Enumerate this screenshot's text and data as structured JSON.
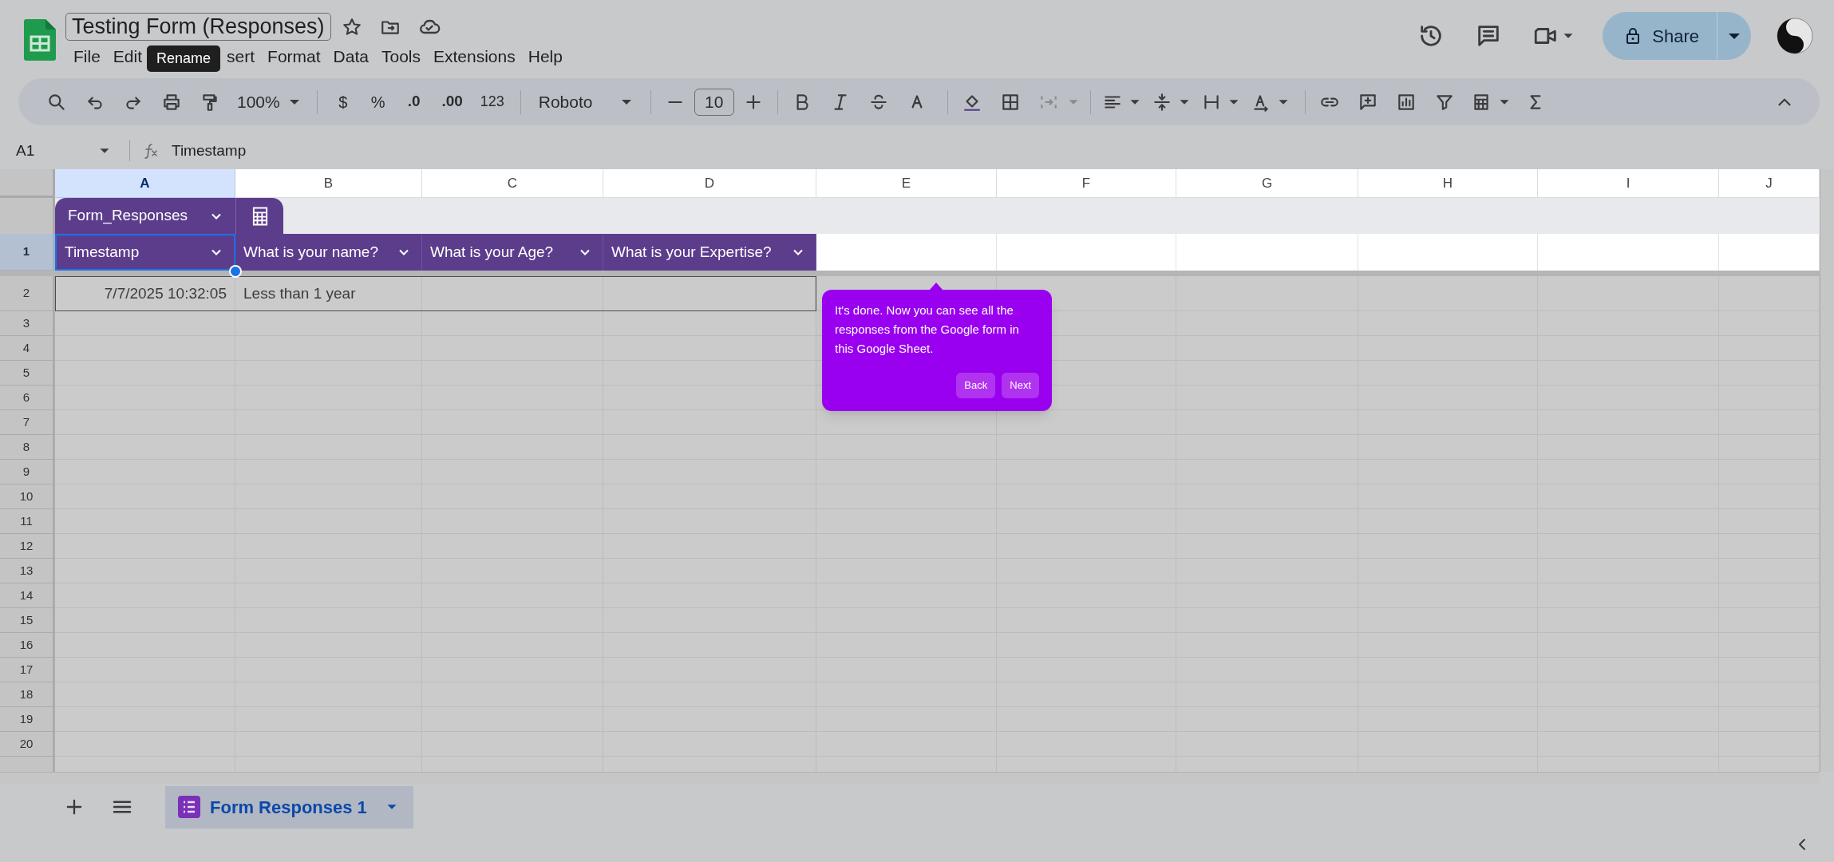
{
  "app": {
    "title": "Testing Form (Responses)",
    "share_label": "Share",
    "menu": [
      {
        "kind": "item",
        "label": "File"
      },
      {
        "kind": "item",
        "label": "Edit"
      },
      {
        "kind": "tooltip",
        "label": "Rename"
      },
      {
        "kind": "item",
        "label": "sert"
      },
      {
        "kind": "item",
        "label": "Format"
      },
      {
        "kind": "item",
        "label": "Data"
      },
      {
        "kind": "item",
        "label": "Tools"
      },
      {
        "kind": "item",
        "label": "Extensions"
      },
      {
        "kind": "item",
        "label": "Help"
      }
    ]
  },
  "toolbar": {
    "zoom": "100%",
    "currency": "$",
    "percent": "%",
    "decrease_decimals": ".0",
    "increase_decimals": ".00",
    "number_format": "123",
    "font": "Roboto",
    "font_size": "10"
  },
  "formula_bar": {
    "cell": "A1",
    "content": "Timestamp"
  },
  "columns": [
    {
      "label": "A",
      "selected": true
    },
    {
      "label": "B",
      "selected": false
    },
    {
      "label": "C",
      "selected": false
    },
    {
      "label": "D",
      "selected": false
    },
    {
      "label": "E",
      "selected": false
    },
    {
      "label": "F",
      "selected": false
    },
    {
      "label": "G",
      "selected": false
    },
    {
      "label": "H",
      "selected": false
    },
    {
      "label": "I",
      "selected": false
    },
    {
      "label": "J",
      "selected": false
    }
  ],
  "table": {
    "name": "Form_Responses",
    "headers": [
      {
        "label": "Timestamp",
        "selected": true
      },
      {
        "label": "What is your name?",
        "selected": false
      },
      {
        "label": "What is your Age?",
        "selected": false
      },
      {
        "label": "What is your Expertise?",
        "selected": false
      }
    ],
    "rows": [
      [
        {
          "text": "7/7/2025 10:32:05",
          "kind": "date"
        },
        {
          "text": "Less than 1 year",
          "kind": "text"
        }
      ]
    ]
  },
  "row_numbers": [
    {
      "label": "1",
      "selected": true
    },
    {
      "label": "2",
      "selected": false
    },
    {
      "label": "3",
      "selected": false
    },
    {
      "label": "4",
      "selected": false
    },
    {
      "label": "5",
      "selected": false
    },
    {
      "label": "6",
      "selected": false
    },
    {
      "label": "7",
      "selected": false
    },
    {
      "label": "8",
      "selected": false
    },
    {
      "label": "9",
      "selected": false
    },
    {
      "label": "10",
      "selected": false
    },
    {
      "label": "11",
      "selected": false
    },
    {
      "label": "12",
      "selected": false
    },
    {
      "label": "13",
      "selected": false
    },
    {
      "label": "14",
      "selected": false
    },
    {
      "label": "15",
      "selected": false
    },
    {
      "label": "16",
      "selected": false
    },
    {
      "label": "17",
      "selected": false
    },
    {
      "label": "18",
      "selected": false
    },
    {
      "label": "19",
      "selected": false
    },
    {
      "label": "20",
      "selected": false
    }
  ],
  "coach_mark": {
    "text": "It's done. Now you can see all the responses from the Google form in this Google Sheet.",
    "buttons": [
      "Back",
      "Next"
    ]
  },
  "sheet_tabs": [
    {
      "label": "Form Responses 1",
      "selected": true
    }
  ]
}
